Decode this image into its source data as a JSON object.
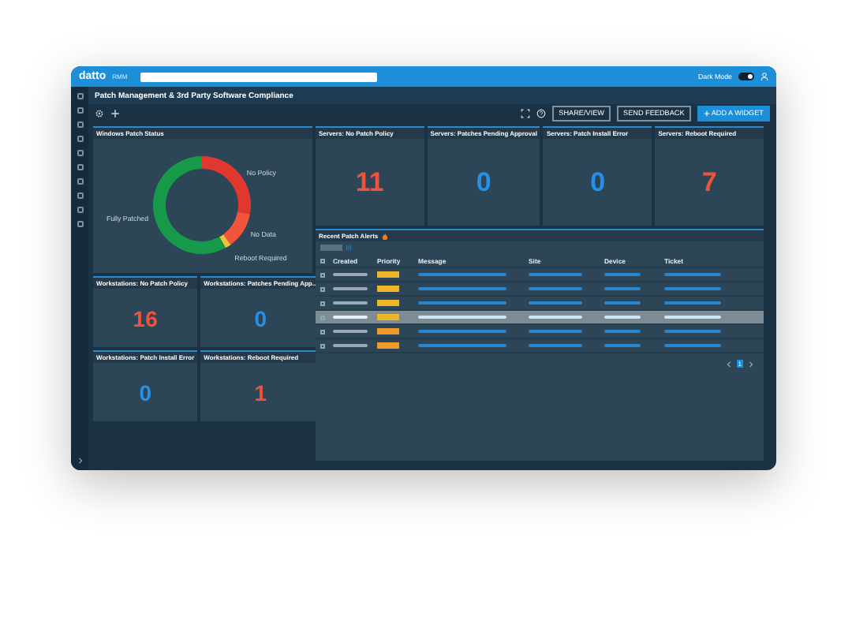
{
  "top_bar": {
    "logo": "datto",
    "product": "RMM",
    "dark_mode": {
      "label": "Dark Mode",
      "on": true
    }
  },
  "page_title": "Patch Management & 3rd Party Software Compliance",
  "toolbar": {
    "buttons": [
      {
        "label": "SHARE/VIEW",
        "kind": "outline"
      },
      {
        "label": "SEND FEEDBACK",
        "kind": "outline"
      },
      {
        "label": "ADD A WIDGET",
        "kind": "primary"
      }
    ]
  },
  "patch_status": {
    "title": "Windows Patch Status",
    "segments": [
      {
        "label": "No Policy",
        "color": "#e0372f"
      },
      {
        "label": "No Data",
        "color": "#f2563a"
      },
      {
        "label": "Reboot Required",
        "color": "#e8c53a"
      },
      {
        "label": "Fully Patched",
        "color": "#17994a"
      }
    ]
  },
  "server_tiles": [
    {
      "title": "Servers: No Patch Policy",
      "value": "11",
      "color": "#f0523a"
    },
    {
      "title": "Servers: Patches Pending Approval",
      "value": "0",
      "color": "#2590e8"
    },
    {
      "title": "Servers: Patch Install Error",
      "value": "0",
      "color": "#2590e8"
    },
    {
      "title": "Servers: Reboot Required",
      "value": "7",
      "color": "#f0523a"
    }
  ],
  "workstation_tiles": [
    {
      "title": "Workstations: No Patch Policy",
      "value": "16",
      "color": "#f0523a"
    },
    {
      "title": "Workstations: Patches Pending App...",
      "value": "0",
      "color": "#2590e8"
    },
    {
      "title": "Workstations: Patch Install Error",
      "value": "0",
      "color": "#2590e8"
    },
    {
      "title": "Workstations: Reboot Required",
      "value": "1",
      "color": "#f0523a"
    }
  ],
  "alerts": {
    "title": "Recent Patch Alerts",
    "columns": [
      "Created",
      "Priority",
      "Message",
      "Site",
      "Device",
      "Ticket"
    ],
    "select_all": {
      "checked": false
    },
    "rows": [
      {
        "selected": false,
        "checked": false,
        "color": "#f0b429"
      },
      {
        "selected": false,
        "checked": false,
        "color": "#f0b429"
      },
      {
        "selected": false,
        "checked": false,
        "color": "#f0b429"
      },
      {
        "selected": true,
        "checked": false,
        "color": "#f0b429"
      },
      {
        "selected": false,
        "checked": false,
        "color": "#f09a29"
      },
      {
        "selected": false,
        "checked": false,
        "color": "#f09a29"
      }
    ],
    "pages": [
      {
        "label": "1",
        "selected": true
      }
    ]
  }
}
